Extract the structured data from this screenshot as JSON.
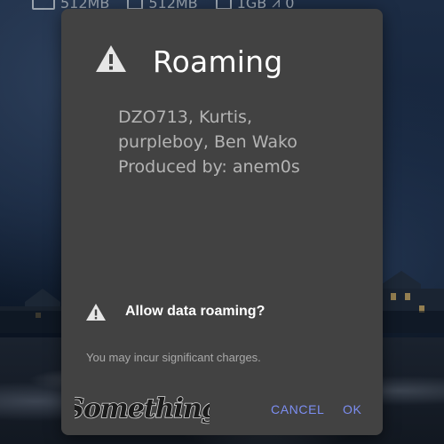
{
  "statusbar": {
    "memory1": "512MB",
    "memory2": "512MB",
    "memory3": "1GB",
    "extra": "0"
  },
  "dialog": {
    "title": "Roaming",
    "message_lines": [
      "DZO713, Kurtis,",
      "purpleboy, Ben Wako",
      "Produced by: anem0s"
    ],
    "question": "Allow data roaming?",
    "warning": "You may incur significant charges.",
    "cancel_label": "CANCEL",
    "ok_label": "OK",
    "logo_text": "Something"
  },
  "colors": {
    "dialog_bg": "#424242",
    "accent": "#7c8ef2",
    "title_text": "#ffffff",
    "message_text": "#b4b4b4"
  }
}
